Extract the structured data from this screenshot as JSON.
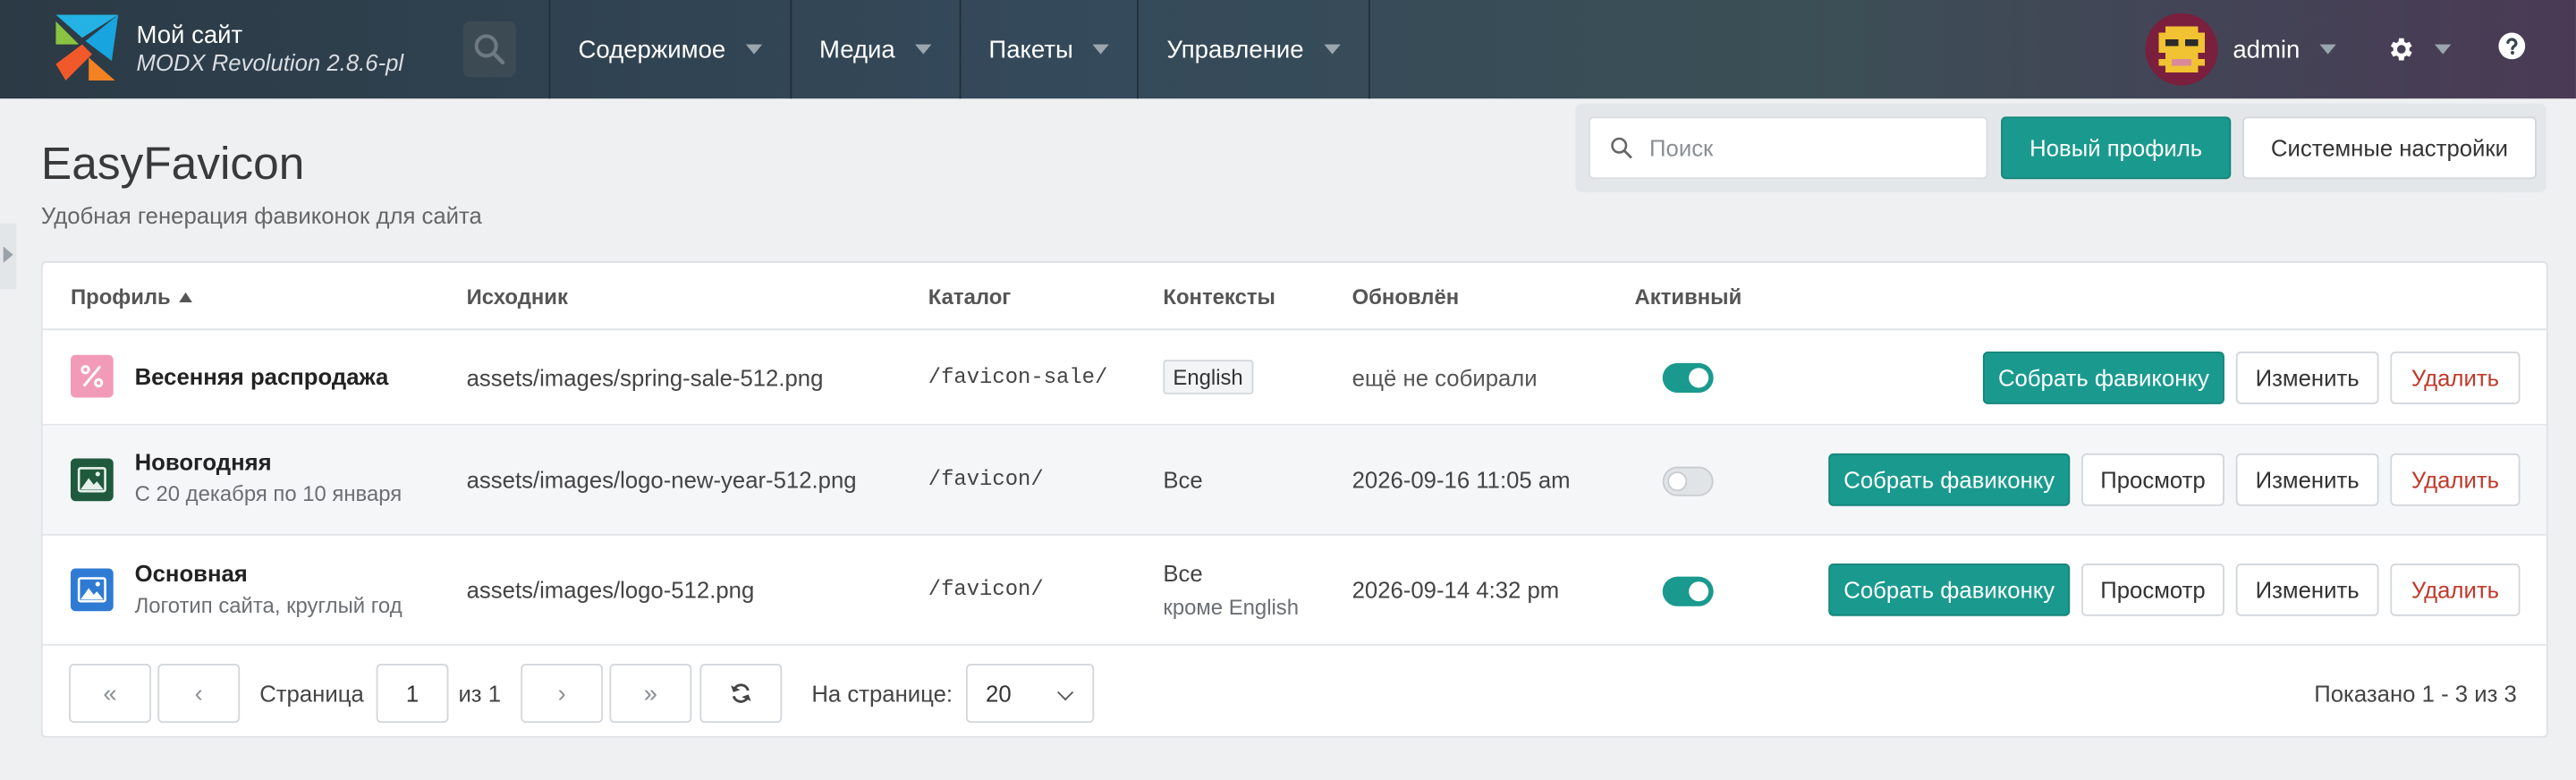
{
  "header": {
    "site_name": "Мой сайт",
    "version": "MODX Revolution 2.8.6-pl",
    "nav": [
      "Содержимое",
      "Медиа",
      "Пакеты",
      "Управление"
    ],
    "username": "admin"
  },
  "page": {
    "title": "EasyFavicon",
    "subtitle": "Удобная генерация фавиконок для сайта"
  },
  "toolbar": {
    "search_placeholder": "Поиск",
    "new_profile": "Новый профиль",
    "system_settings": "Системные настройки"
  },
  "grid": {
    "columns": [
      "Профиль",
      "Исходник",
      "Каталог",
      "Контексты",
      "Обновлён",
      "Активный"
    ],
    "rows": [
      {
        "icon": "percent-icon",
        "icon_color": "#f29bb8",
        "name": "Весенняя распродажа",
        "desc": "",
        "source": "assets/images/spring-sale-512.png",
        "dir": "/favicon-sale/",
        "contexts": "English",
        "contexts_sub": "",
        "updated": "ещё не собирали",
        "active": true,
        "build": "Собрать фавиконку",
        "view": "",
        "edit": "Изменить",
        "delete": "Удалить"
      },
      {
        "icon": "landscape-icon",
        "icon_color": "#1f5a3c",
        "name": "Новогодняя",
        "desc": "С 20 декабря по 10 января",
        "source": "assets/images/logo-new-year-512.png",
        "dir": "/favicon/",
        "contexts": "Все",
        "contexts_sub": "",
        "updated": "2026-09-16 11:05 am",
        "active": false,
        "build": "Собрать фавиконку",
        "view": "Просмотр",
        "edit": "Изменить",
        "delete": "Удалить"
      },
      {
        "icon": "image-icon",
        "icon_color": "#2f7bd3",
        "name": "Основная",
        "desc": "Логотип сайта, круглый год",
        "source": "assets/images/logo-512.png",
        "dir": "/favicon/",
        "contexts": "Все",
        "contexts_sub": "кроме English",
        "updated": "2026-09-14 4:32 pm",
        "active": true,
        "build": "Собрать фавиконку",
        "view": "Просмотр",
        "edit": "Изменить",
        "delete": "Удалить"
      }
    ]
  },
  "pager": {
    "page_label": "Страница",
    "page_value": "1",
    "of_label": "из 1",
    "per_page_label": "На странице:",
    "per_page_value": "20",
    "summary": "Показано 1 - 3 из 3"
  },
  "colors": {
    "accent": "#1a9a8e",
    "danger": "#c0392b"
  }
}
